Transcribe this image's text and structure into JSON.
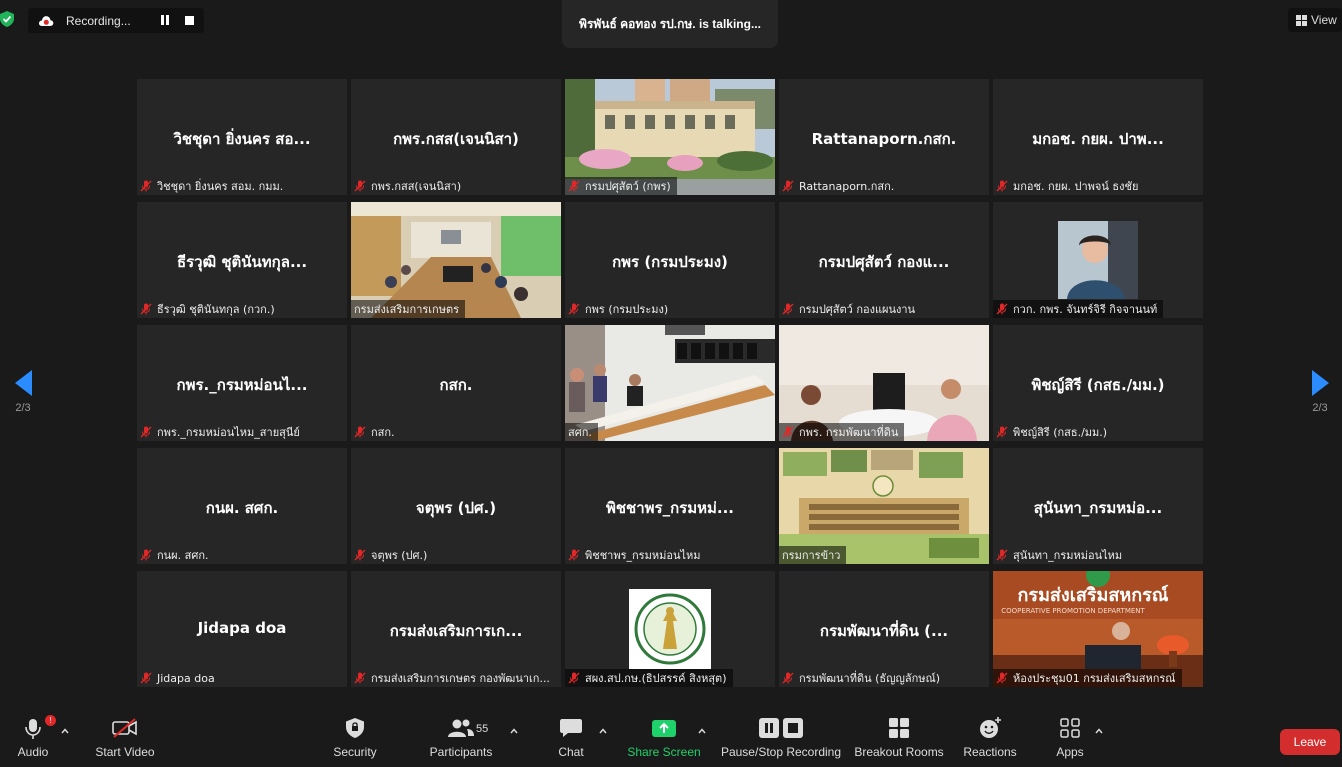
{
  "recording": {
    "label": "Recording..."
  },
  "speaker": {
    "text": "พิรพันธ์ คอทอง รป.กษ. is  talking..."
  },
  "view": {
    "label": "View"
  },
  "pager": {
    "left": "2/3",
    "right": "2/3"
  },
  "tiles": [
    {
      "title": "วิชชุดา ยิ่งนคร สอ...",
      "name": "วิชชุดา ยิ่งนคร สอม. กมม."
    },
    {
      "title": "กพร.กสส(เจนนิสา)",
      "name": "กพร.กสส(เจนนิสา)"
    },
    {
      "title": "",
      "name": "กรมปศุสัตว์ (กพร)"
    },
    {
      "title": "Rattanaporn.กสก.",
      "name": "Rattanaporn.กสก."
    },
    {
      "title": "มกอช. กยผ. ปาพ...",
      "name": "มกอช. กยผ. ปาพจน์ ธงชัย"
    },
    {
      "title": "ธีรวุฒิ ชุตินันทกุล...",
      "name": "ธีรวุฒิ ชุตินันทกุล (กวก.)"
    },
    {
      "title": "",
      "name": "กรมส่งเสริมการเกษตร"
    },
    {
      "title": "กพร (กรมประมง)",
      "name": "กพร (กรมประมง)"
    },
    {
      "title": "กรมปศุสัตว์ กองแ...",
      "name": "กรมปศุสัตว์ กองแผนงาน"
    },
    {
      "title": "",
      "name": "กวก. กพร. จันทร์จิรี กิจจานนท์"
    },
    {
      "title": "กพร._กรมหม่อนไ...",
      "name": "กพร._กรมหม่อนไหม_สายสุนีย์"
    },
    {
      "title": "กสก.",
      "name": "กสก."
    },
    {
      "title": "",
      "name": "สศก."
    },
    {
      "title": "",
      "name": "กพร. กรมพัฒนาที่ดิน"
    },
    {
      "title": "พิชญ์สิรี (กสธ./มม.)",
      "name": "พิชญ์สิรี (กสธ./มม.)"
    },
    {
      "title": "กนผ. สศก.",
      "name": "กนผ. สศก."
    },
    {
      "title": "จตุพร (ปศ.)",
      "name": "จตุพร (ปศ.)"
    },
    {
      "title": "พิชชาพร_กรมหม่...",
      "name": "พิชชาพร_กรมหม่อนไหม"
    },
    {
      "title": "",
      "name": "กรมการข้าว"
    },
    {
      "title": "สุนันทา_กรมหม่อ...",
      "name": "สุนันทา_กรมหม่อนไหม"
    },
    {
      "title": "Jidapa doa",
      "name": "Jidapa doa"
    },
    {
      "title": "กรมส่งเสริมการเก...",
      "name": "กรมส่งเสริมการเกษตร กองพัฒนาเก..."
    },
    {
      "title": "",
      "name": "สผง.สป.กษ.(ธิปสรรค์ สิงหสุต)"
    },
    {
      "title": "กรมพัฒนาที่ดิน (...",
      "name": "กรมพัฒนาที่ดิน (ธัญญลักษณ์)"
    },
    {
      "title": "",
      "name": "ห้องประชุม01 กรมส่งเสริมสหกรณ์"
    }
  ],
  "scene_text": {
    "coop_sign": "กรมส่งเสริมสหกรณ์",
    "coop_sub": "COOPERATIVE PROMOTION DEPARTMENT"
  },
  "toolbar": {
    "audio": "Audio",
    "audio_badge": "!",
    "video": "Start Video",
    "security": "Security",
    "participants": "Participants",
    "participants_count": "55",
    "chat": "Chat",
    "share": "Share Screen",
    "record": "Pause/Stop Recording",
    "breakout": "Breakout Rooms",
    "reactions": "Reactions",
    "apps": "Apps",
    "leave": "Leave"
  },
  "colors": {
    "accent": "#2b8cff",
    "share": "#1fd16b",
    "leave": "#d32d2d",
    "muted": "#e02828"
  }
}
